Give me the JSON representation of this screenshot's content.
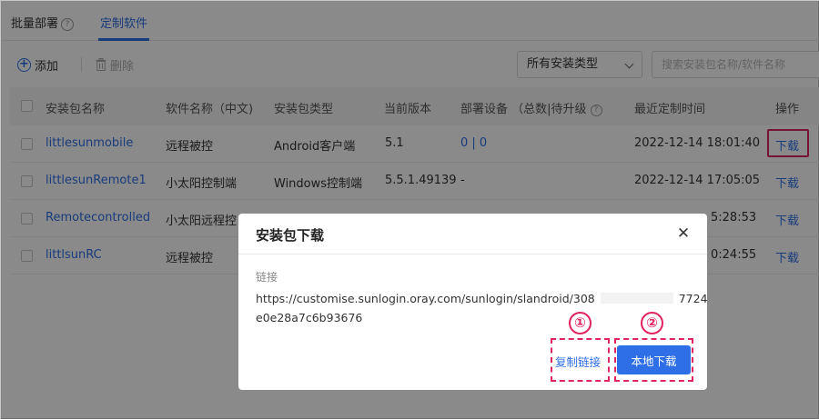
{
  "tabs": [
    {
      "label": "批量部署"
    },
    {
      "label": "定制软件"
    }
  ],
  "toolbar": {
    "add_label": "添加",
    "delete_label": "删除",
    "type_filter": "所有安装类型",
    "search_placeholder": "搜索安装包名称/软件名称"
  },
  "table": {
    "columns": [
      "安装包名称",
      "软件名称（中文)",
      "安装包类型",
      "当前版本",
      "部署设备 （总数|待升级",
      "最近定制时间",
      "操作"
    ],
    "rows": [
      {
        "package": "littlesunmobile",
        "software": "远程被控",
        "type": "Android客户端",
        "version": "5.1",
        "devices": "0 | 0",
        "time": "2022-12-14 18:01:40",
        "action": "下载"
      },
      {
        "package": "littlesunRemote1",
        "software": "小太阳控制端",
        "type": "Windows控制端",
        "version": "5.5.1.49139",
        "devices": "-",
        "time": "2022-12-14 17:05:05",
        "action": "下载"
      },
      {
        "package": "Remotecontrolled",
        "software": "小太阳远程控",
        "type": "",
        "version": "",
        "devices": "",
        "time": "5:28:53",
        "action": "下载"
      },
      {
        "package": "littlsunRC",
        "software": "远程被控",
        "type": "",
        "version": "",
        "devices": "",
        "time": "0:24:55",
        "action": "下载"
      }
    ]
  },
  "modal": {
    "title": "安装包下载",
    "link_label": "链接",
    "url_line1_start": "https://customise.sunlogin.oray.com/sunlogin/slandroid/308",
    "url_line1_end": "7724",
    "url_line2": "e0e28a7c6b93676",
    "copy_label": "复制链接",
    "download_label": "本地下载"
  },
  "annotations": {
    "step1": "①",
    "step2": "②"
  },
  "colors": {
    "accent": "#2e6ee6",
    "annotation": "#e0245e"
  }
}
